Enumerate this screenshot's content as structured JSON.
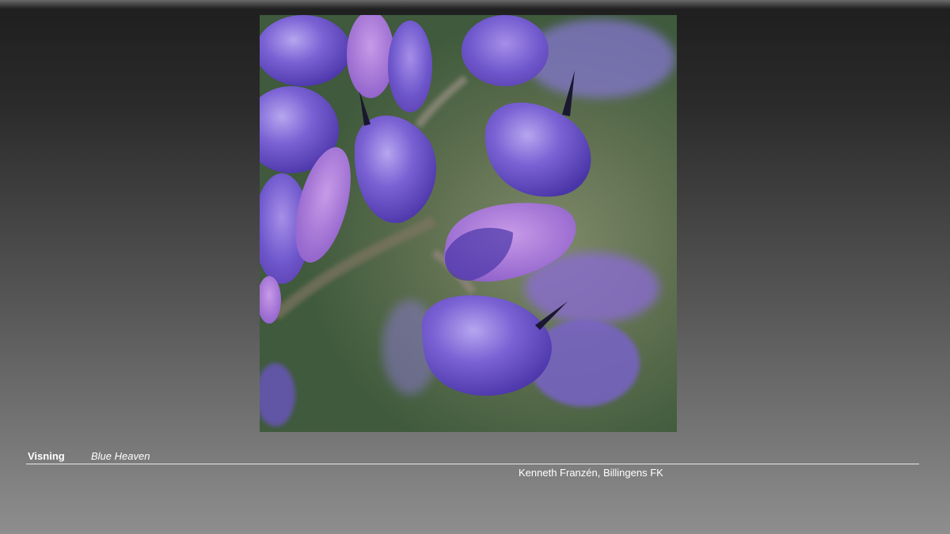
{
  "slide": {
    "label": "Visning",
    "title": "Blue Heaven",
    "credit": "Kenneth Franzén, Billingens FK"
  },
  "photo": {
    "subject": "lupine-flower-macro",
    "colors": {
      "petal": "#6b55c9",
      "petal_light": "#9a86e0",
      "stem": "#8a7a6a",
      "background": "#5f7050"
    }
  }
}
